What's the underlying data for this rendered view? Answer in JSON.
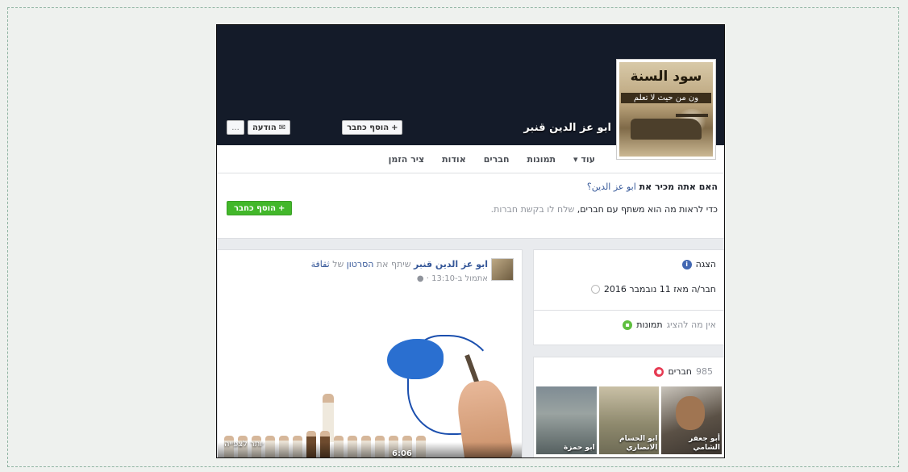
{
  "cover": {
    "profile_name": "ابو عز الدين قنبر",
    "profile_pic_title": "سود السنة",
    "profile_pic_subtitle": "ون من حيث لا تعلم",
    "buttons": {
      "message": "הודעה",
      "add_friend": "הוסף כחבר",
      "more": "..."
    }
  },
  "nav": {
    "items": [
      "ציר הזמן",
      "אודות",
      "חברים",
      "תמונות",
      "עוד"
    ]
  },
  "know_banner": {
    "question_prefix": "האם אתה מכיר את",
    "question_name": "ابو عز الدين؟",
    "description_main": "כדי לראות מה הוא משתף עם חברים,",
    "description_rest": " שלח לו בקשת חברות.",
    "add_friend_button": "הוסף כחבר"
  },
  "sidebar": {
    "intro": {
      "title": "הצגה",
      "line": "חבר/ה מאז 11 נובמבר 2016"
    },
    "photos": {
      "title": "תמונות",
      "empty_text": "אין מה להציג"
    },
    "friends": {
      "title": "חברים",
      "count": "985",
      "tiles": [
        {
          "name": "أبو جعفر الشامي"
        },
        {
          "name": "ابو الحسام الانصاري"
        },
        {
          "name": "ابو حمزة"
        }
      ]
    }
  },
  "post": {
    "author": "ابو عز الدين قنبر",
    "action": " שיתף את ",
    "object": "הסרטון",
    "of": " של ",
    "source": "ثقافة",
    "time": "אתמול ב-13:10",
    "video": {
      "duration": "6:06",
      "caption": "יותר לצפייה"
    }
  },
  "colors": {
    "cover_bg": "#141b29",
    "accent_blue": "#365899",
    "green_button": "#42b72a"
  }
}
